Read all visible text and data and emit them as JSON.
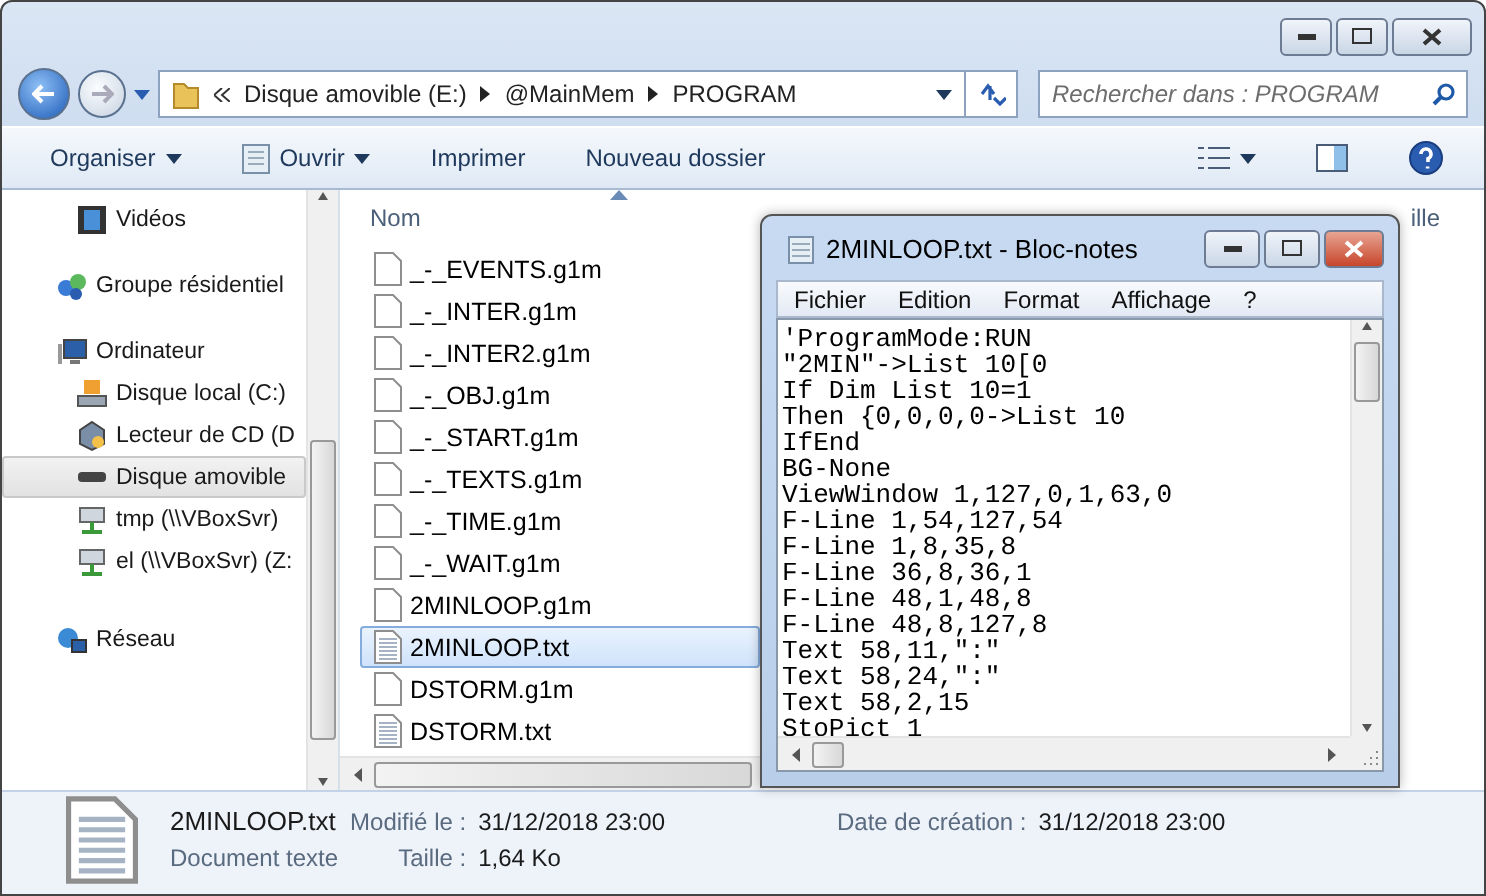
{
  "address": {
    "crumbs": [
      "Disque amovible (E:)",
      "@MainMem",
      "PROGRAM"
    ]
  },
  "search": {
    "placeholder": "Rechercher dans : PROGRAM"
  },
  "toolbar": {
    "buttons": [
      {
        "label": "Organiser",
        "dropdown": true,
        "icon": false
      },
      {
        "label": "Ouvrir",
        "dropdown": true,
        "icon": true
      },
      {
        "label": "Imprimer",
        "dropdown": false,
        "icon": false
      },
      {
        "label": "Nouveau dossier",
        "dropdown": false,
        "icon": false
      }
    ]
  },
  "sidebar": {
    "items": [
      {
        "label": "Vidéos",
        "kind": "videos",
        "selected": false
      },
      {
        "label": "Groupe résidentiel",
        "kind": "homegroup",
        "selected": false
      },
      {
        "label": "Ordinateur",
        "kind": "computer",
        "selected": false,
        "children": [
          {
            "label": "Disque local (C:)",
            "kind": "disk",
            "selected": false
          },
          {
            "label": "Lecteur de CD (D",
            "kind": "cd",
            "selected": false
          },
          {
            "label": "Disque amovible",
            "kind": "removable",
            "selected": true
          },
          {
            "label": "tmp (\\\\VBoxSvr)",
            "kind": "network",
            "selected": false
          },
          {
            "label": "el (\\\\VBoxSvr) (Z:",
            "kind": "network",
            "selected": false
          }
        ]
      },
      {
        "label": "Réseau",
        "kind": "network-globe",
        "selected": false
      }
    ]
  },
  "file_list": {
    "columns": [
      "Nom",
      "ille"
    ],
    "rows": [
      {
        "name": "_-_EVENTS.g1m",
        "kind": "blank",
        "selected": false
      },
      {
        "name": "_-_INTER.g1m",
        "kind": "blank",
        "selected": false
      },
      {
        "name": "_-_INTER2.g1m",
        "kind": "blank",
        "selected": false
      },
      {
        "name": "_-_OBJ.g1m",
        "kind": "blank",
        "selected": false
      },
      {
        "name": "_-_START.g1m",
        "kind": "blank",
        "selected": false
      },
      {
        "name": "_-_TEXTS.g1m",
        "kind": "blank",
        "selected": false
      },
      {
        "name": "_-_TIME.g1m",
        "kind": "blank",
        "selected": false
      },
      {
        "name": "_-_WAIT.g1m",
        "kind": "blank",
        "selected": false
      },
      {
        "name": "2MINLOOP.g1m",
        "kind": "blank",
        "selected": false
      },
      {
        "name": "2MINLOOP.txt",
        "kind": "text",
        "selected": true
      },
      {
        "name": "DSTORM.g1m",
        "kind": "blank",
        "selected": false
      },
      {
        "name": "DSTORM.txt",
        "kind": "text",
        "selected": false
      }
    ]
  },
  "details": {
    "name": "2MINLOOP.txt",
    "type": "Document texte",
    "fields": [
      {
        "label": "Modifié le :",
        "value": "31/12/2018 23:00"
      },
      {
        "label": "Taille :",
        "value": "1,64 Ko"
      },
      {
        "label": "Date de création :",
        "value": "31/12/2018 23:00"
      }
    ]
  },
  "notepad": {
    "title": "2MINLOOP.txt - Bloc-notes",
    "menus": [
      "Fichier",
      "Edition",
      "Format",
      "Affichage",
      "?"
    ],
    "lines": [
      "'ProgramMode:RUN",
      "\"2MIN\"->List 10[0",
      "If Dim List 10=1",
      "Then {0,0,0,0->List 10",
      "IfEnd",
      "BG-None",
      "ViewWindow 1,127,0,1,63,0",
      "F-Line 1,54,127,54",
      "F-Line 1,8,35,8",
      "F-Line 36,8,36,1",
      "F-Line 48,1,48,8",
      "F-Line 48,8,127,8",
      "Text 58,11,\":\"",
      "Text 58,24,\":\"",
      "Text 58,2,15",
      "StoPict 1"
    ]
  }
}
